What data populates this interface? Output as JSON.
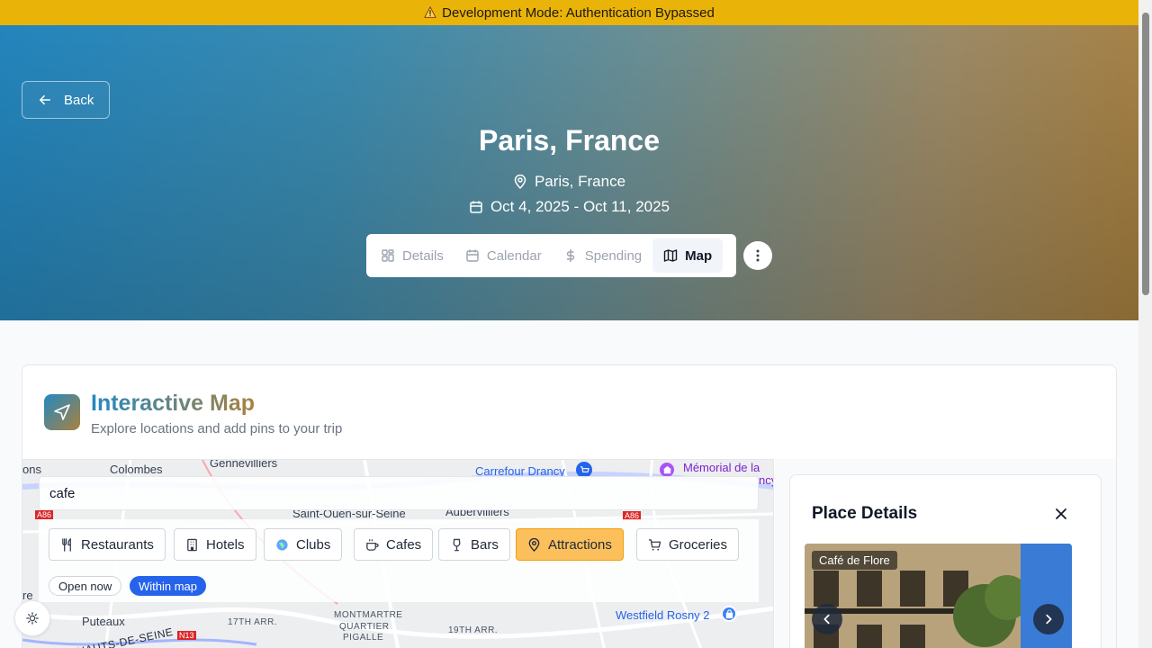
{
  "banner": {
    "icon": "warning-icon",
    "text": "Development Mode: Authentication Bypassed"
  },
  "header": {
    "back_label": "Back",
    "title": "Paris, France",
    "location": "Paris, France",
    "dates": "Oct 4, 2025 - Oct 11, 2025"
  },
  "tabs": [
    {
      "label": "Details",
      "icon": "grid-icon",
      "active": false
    },
    {
      "label": "Calendar",
      "icon": "calendar-icon",
      "active": false
    },
    {
      "label": "Spending",
      "icon": "dollar-icon",
      "active": false
    },
    {
      "label": "Map",
      "icon": "map-icon",
      "active": true
    }
  ],
  "map_card": {
    "title": "Interactive Map",
    "subtitle": "Explore locations and add pins to your trip",
    "search_value": "cafe",
    "categories": [
      {
        "label": "Restaurants",
        "icon": "utensils-icon",
        "active": false
      },
      {
        "label": "Hotels",
        "icon": "building-icon",
        "active": false
      },
      {
        "label": "Clubs",
        "icon": "globe-icon",
        "active": false
      },
      {
        "label": "Cafes",
        "icon": "coffee-icon",
        "active": false
      },
      {
        "label": "Bars",
        "icon": "wine-icon",
        "active": false
      },
      {
        "label": "Attractions",
        "icon": "map-pin-icon",
        "active": true
      },
      {
        "label": "Groceries",
        "icon": "cart-icon",
        "active": false
      }
    ],
    "toggles": [
      {
        "label": "Open now",
        "active": false
      },
      {
        "label": "Within map",
        "active": true
      }
    ],
    "map_labels": {
      "colombes": "Colombes",
      "gennevilliers": "Gennevilliers",
      "carrefour": "Carrefour Drancy",
      "memorial": "Mémorial de la",
      "memorial2": "ncy",
      "saint_ouen": "Saint-Ouen-sur-Seine",
      "aubervilliers": "Aubervilliers",
      "puteaux": "Puteaux",
      "arr17": "17TH ARR.",
      "montmartre": "MONTMARTRE",
      "quartier": "QUARTIER",
      "pigalle": "PIGALLE",
      "arr19": "19TH ARR.",
      "westfield": "Westfield Rosny 2",
      "hauts_seine": "HAUTS-DE-SEINE",
      "a86": "A86",
      "a86b": "A86",
      "n13": "N13",
      "ons": "ons",
      "re": "re"
    }
  },
  "place_details": {
    "title": "Place Details",
    "photo_caption": "Café de Flore"
  },
  "colors": {
    "banner": "#eab308",
    "accent_blue": "#2563eb",
    "accent_orange": "#fbbf5c",
    "gradient_start": "#2388c2",
    "gradient_end": "#a9823f"
  }
}
